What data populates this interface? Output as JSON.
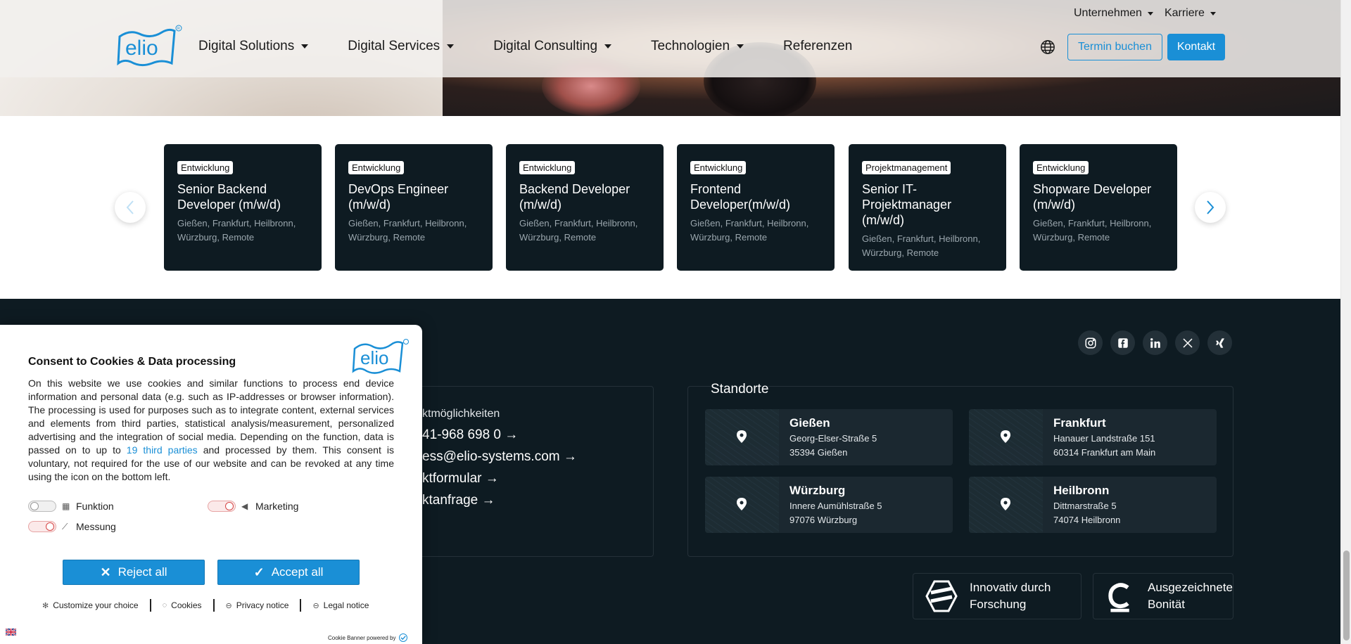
{
  "header": {
    "nav": [
      {
        "label": "Digital Solutions",
        "dropdown": true
      },
      {
        "label": "Digital Services",
        "dropdown": true
      },
      {
        "label": "Digital Consulting",
        "dropdown": true
      },
      {
        "label": "Technologien",
        "dropdown": true
      },
      {
        "label": "Referenzen",
        "dropdown": false
      }
    ],
    "top_links": [
      "Unternehmen",
      "Karriere"
    ],
    "termin_label": "Termin buchen",
    "kontakt_label": "Kontakt",
    "accent": "#1a8fd6",
    "logo_text": "elio"
  },
  "jobs": [
    {
      "tag": "Entwicklung",
      "title": "Senior Backend Developer (m/w/d)",
      "locations": "Gießen, Frankfurt, Heilbronn, Würzburg, Remote"
    },
    {
      "tag": "Entwicklung",
      "title": "DevOps Engineer (m/w/d)",
      "locations": "Gießen, Frankfurt, Heilbronn, Würzburg, Remote"
    },
    {
      "tag": "Entwicklung",
      "title": "Backend Developer (m/w/d)",
      "locations": "Gießen, Frankfurt, Heilbronn, Würzburg, Remote"
    },
    {
      "tag": "Entwicklung",
      "title": "Frontend Developer(m/w/d)",
      "locations": "Gießen, Frankfurt, Heilbronn, Würzburg, Remote"
    },
    {
      "tag": "Projektmanagement",
      "title": "Senior IT-Projektmanager (m/w/d)",
      "locations": "Gießen, Frankfurt, Heilbronn, Würzburg, Remote"
    },
    {
      "tag": "Entwicklung",
      "title": "Shopware Developer (m/w/d)",
      "locations": "Gießen, Frankfurt, Heilbronn, Würzburg, Remote"
    }
  ],
  "footer": {
    "socials": [
      "instagram-icon",
      "facebook-icon",
      "linkedin-icon",
      "x-icon",
      "xing-icon"
    ],
    "kontakt": {
      "heading": "ktmöglichkeiten",
      "phone": "41-968 698 0 →",
      "email": "ess@elio-systems.com →",
      "form": "ktformular →",
      "request": "ktanfrage →"
    },
    "standorte_title": "Standorte",
    "locations": [
      {
        "city": "Gießen",
        "street": "Georg-Elser-Straße 5",
        "zip_city": "35394 Gießen"
      },
      {
        "city": "Frankfurt",
        "street": "Hanauer Landstraße 151",
        "zip_city": "60314 Frankfurt am Main"
      },
      {
        "city": "Würzburg",
        "street": "Innere Aumühlstraße 5",
        "zip_city": "97076 Würzburg"
      },
      {
        "city": "Heilbronn",
        "street": "Dittmarstraße 5",
        "zip_city": "74074 Heilbronn"
      }
    ],
    "badges": [
      {
        "line1": "Innovativ durch",
        "line2": "Forschung"
      },
      {
        "line1": "Ausgezeichnete",
        "line2": "Bonität"
      }
    ]
  },
  "cookie": {
    "title": "Consent to Cookies & Data processing",
    "body_before": "On this website we use cookies and similar functions to process end device information and personal data (e.g. such as IP-addresses or browser information). The processing is used for purposes such as to integrate content, external services and elements from third parties, statistical analysis/measurement, personalized advertising and the integration of social media. Depending on the function, data is passed on to up to ",
    "body_link": "19 third parties",
    "body_after": " and processed by them. This consent is voluntary, not required for the use of our website and can be revoked at any time using the icon on the bottom left.",
    "toggles": {
      "funktion": "Funktion",
      "marketing": "Marketing",
      "messung": "Messung"
    },
    "reject_label": "Reject all",
    "accept_label": "Accept all",
    "links": {
      "customize": "Customize your choice",
      "cookies": "Cookies",
      "privacy": "Privacy notice",
      "legal": "Legal notice"
    },
    "powered": "Cookie Banner powered by"
  }
}
